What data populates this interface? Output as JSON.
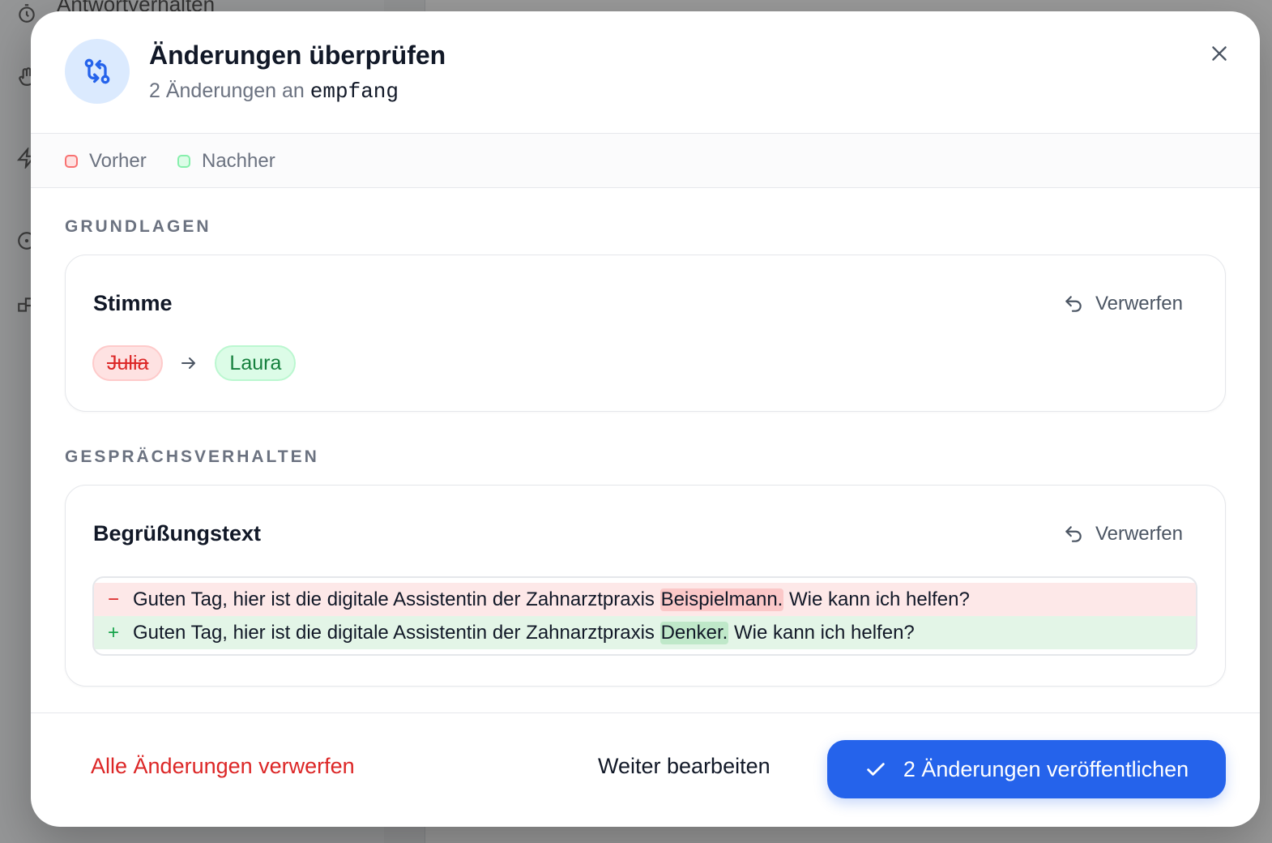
{
  "background": {
    "sidebar_partial_label": "Antwortverhalten"
  },
  "modal": {
    "title": "Änderungen überprüfen",
    "subtitle_prefix": "2 Änderungen an",
    "subtitle_target": "empfang",
    "close_icon": "close-icon",
    "header_icon": "git-compare-icon"
  },
  "legend": {
    "before": "Vorher",
    "after": "Nachher"
  },
  "sections": [
    {
      "heading": "GRUNDLAGEN",
      "card": {
        "title": "Stimme",
        "discard_label": "Verwerfen",
        "old_value": "Julia",
        "new_value": "Laura"
      }
    },
    {
      "heading": "GESPRÄCHSVERHALTEN",
      "card": {
        "title": "Begrüßungstext",
        "discard_label": "Verwerfen",
        "removed": {
          "sign": "−",
          "prefix": "Guten Tag, hier ist die digitale Assistentin der Zahnarztpraxis",
          "highlight": "Beispielmann.",
          "suffix": "Wie kann ich helfen?"
        },
        "added": {
          "sign": "+",
          "prefix": "Guten Tag, hier ist die digitale Assistentin der Zahnarztpraxis",
          "highlight": "Denker.",
          "suffix": "Wie kann ich helfen?"
        }
      }
    }
  ],
  "footer": {
    "discard_all": "Alle Änderungen verwerfen",
    "continue_editing": "Weiter bearbeiten",
    "publish": "2 Änderungen veröffentlichen"
  },
  "colors": {
    "accent": "#2563eb",
    "danger": "#dc2626",
    "success": "#15803d",
    "removed_bg": "#fde8e8",
    "added_bg": "#e3f5e7"
  }
}
